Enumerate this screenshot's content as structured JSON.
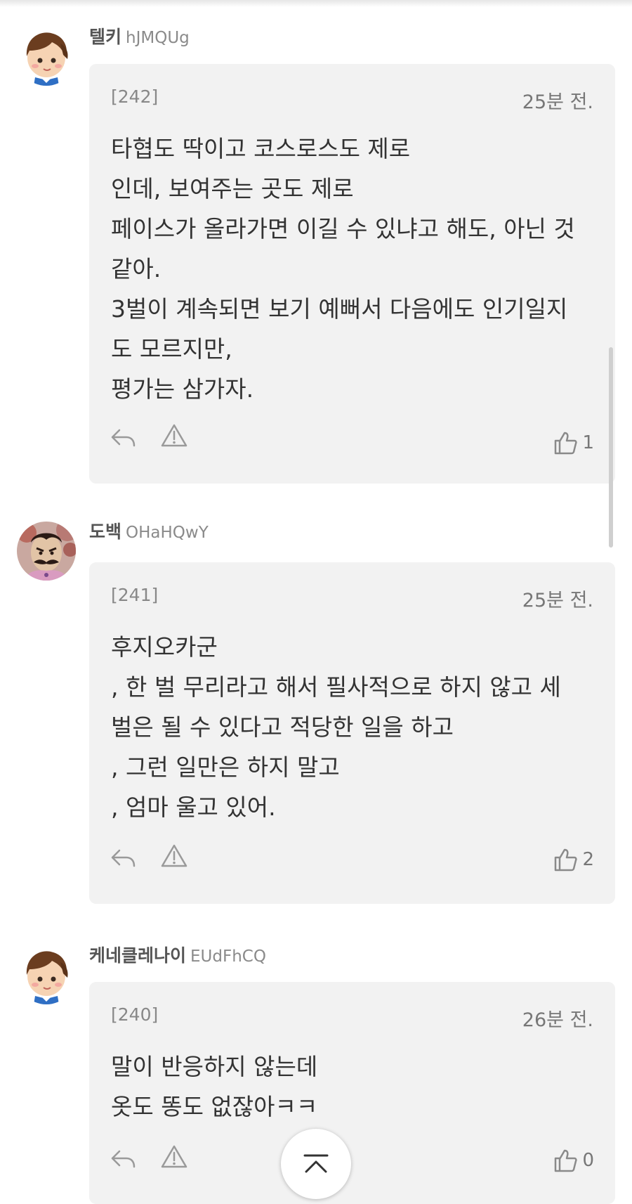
{
  "comments": [
    {
      "author_name": "텔키",
      "author_id": "hJMQUg",
      "number": "[242]",
      "time": "25분 전.",
      "lines": [
        "타협도 딱이고 코스로스도 제로",
        "인데, 보여주는 곳도 제로",
        "페이스가 올라가면 이길 수 있냐고 해도, 아닌 것",
        "같아.",
        "3벌이 계속되면 보기 예뻐서 다음에도 인기일지",
        "도 모르지만,",
        "평가는 삼가자."
      ],
      "likes": "1",
      "avatar_icon": "boy-avatar-icon"
    },
    {
      "author_name": "도백",
      "author_id": "OHaHQwY",
      "number": "[241]",
      "time": "25분 전.",
      "lines": [
        "후지오카군",
        ", 한 벌 무리라고 해서 필사적으로 하지 않고 세",
        "벌은 될 수 있다고 적당한 일을 하고",
        ", 그런 일만은 하지 말고",
        ", 엄마 울고 있어."
      ],
      "likes": "2",
      "avatar_icon": "mustache-man-avatar-icon"
    },
    {
      "author_name": "케네클레나이",
      "author_id": "EUdFhCQ",
      "number": "[240]",
      "time": "26분 전.",
      "lines": [
        "말이 반응하지 않는데",
        "옷도 똥도 없잖아ㅋㅋ"
      ],
      "likes": "0",
      "avatar_icon": "boy-avatar-icon"
    }
  ],
  "icons": {
    "reply": "reply-icon",
    "report": "warning-icon",
    "like": "thumbs-up-icon",
    "scroll_top": "chevron-up-icon"
  },
  "colors": {
    "bubble_bg": "#f2f2f2",
    "text": "#333333",
    "muted": "#888888"
  }
}
